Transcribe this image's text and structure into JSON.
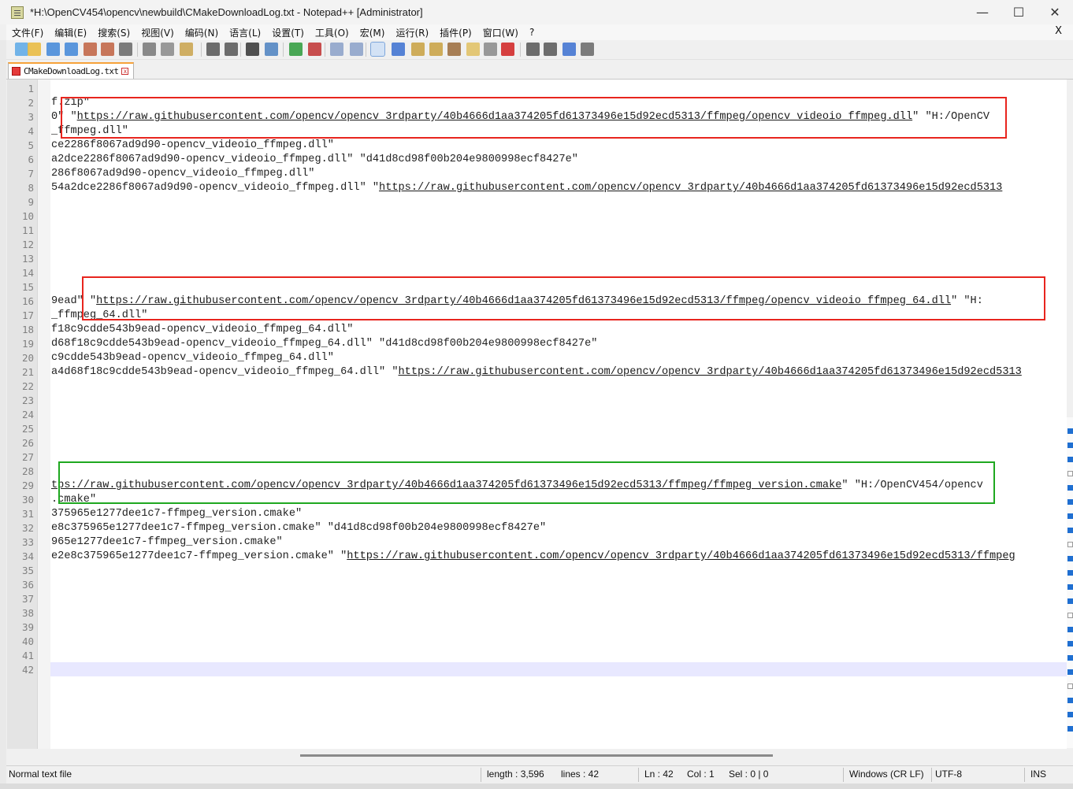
{
  "window": {
    "title": "*H:\\OpenCV454\\opencv\\newbuild\\CMakeDownloadLog.txt - Notepad++ [Administrator]",
    "controls": {
      "minimize": "—",
      "maximize": "☐",
      "close": "✕"
    }
  },
  "menu": {
    "items": [
      "文件(F)",
      "编辑(E)",
      "搜索(S)",
      "视图(V)",
      "编码(N)",
      "语言(L)",
      "设置(T)",
      "工具(O)",
      "宏(M)",
      "运行(R)",
      "插件(P)",
      "窗口(W)",
      "?"
    ],
    "close_label": "X"
  },
  "tab": {
    "label": "CMakeDownloadLog.txt",
    "close": "x"
  },
  "line_numbers": [
    "1",
    "2",
    "3",
    "4",
    "5",
    "6",
    "7",
    "8",
    "9",
    "10",
    "11",
    "12",
    "13",
    "14",
    "15",
    "16",
    "17",
    "18",
    "19",
    "20",
    "21",
    "22",
    "23",
    "24",
    "25",
    "26",
    "27",
    "28",
    "29",
    "30",
    "31",
    "32",
    "33",
    "34",
    "35",
    "36",
    "37",
    "38",
    "39",
    "40",
    "41",
    "42"
  ],
  "lines": [
    {
      "pre": "",
      "url": "",
      "post": ""
    },
    {
      "pre": "f.zip\"",
      "url": "",
      "post": ""
    },
    {
      "pre": "0\" \"",
      "url": "https://raw.githubusercontent.com/opencv/opencv_3rdparty/40b4666d1aa374205fd61373496e15d92ecd5313/ffmpeg/opencv_videoio_ffmpeg.dll",
      "post": "\" \"H:/OpenCV"
    },
    {
      "pre": "_ffmpeg.dll\"",
      "url": "",
      "post": ""
    },
    {
      "pre": "ce2286f8067ad9d90-opencv_videoio_ffmpeg.dll\"",
      "url": "",
      "post": ""
    },
    {
      "pre": "a2dce2286f8067ad9d90-opencv_videoio_ffmpeg.dll\" \"d41d8cd98f00b204e9800998ecf8427e\"",
      "url": "",
      "post": ""
    },
    {
      "pre": "286f8067ad9d90-opencv_videoio_ffmpeg.dll\"",
      "url": "",
      "post": ""
    },
    {
      "pre": "54a2dce2286f8067ad9d90-opencv_videoio_ffmpeg.dll\" \"",
      "url": "https://raw.githubusercontent.com/opencv/opencv_3rdparty/40b4666d1aa374205fd61373496e15d92ecd5313",
      "post": ""
    },
    {
      "pre": "",
      "url": "",
      "post": ""
    },
    {
      "pre": "",
      "url": "",
      "post": ""
    },
    {
      "pre": "",
      "url": "",
      "post": ""
    },
    {
      "pre": "",
      "url": "",
      "post": ""
    },
    {
      "pre": "",
      "url": "",
      "post": ""
    },
    {
      "pre": "",
      "url": "",
      "post": ""
    },
    {
      "pre": "",
      "url": "",
      "post": ""
    },
    {
      "pre": "9ead\" \"",
      "url": "https://raw.githubusercontent.com/opencv/opencv_3rdparty/40b4666d1aa374205fd61373496e15d92ecd5313/ffmpeg/opencv_videoio_ffmpeg_64.dll",
      "post": "\" \"H:"
    },
    {
      "pre": "_ffmpeg_64.dll\"",
      "url": "",
      "post": ""
    },
    {
      "pre": "f18c9cdde543b9ead-opencv_videoio_ffmpeg_64.dll\"",
      "url": "",
      "post": ""
    },
    {
      "pre": "d68f18c9cdde543b9ead-opencv_videoio_ffmpeg_64.dll\" \"d41d8cd98f00b204e9800998ecf8427e\"",
      "url": "",
      "post": ""
    },
    {
      "pre": "c9cdde543b9ead-opencv_videoio_ffmpeg_64.dll\"",
      "url": "",
      "post": ""
    },
    {
      "pre": "a4d68f18c9cdde543b9ead-opencv_videoio_ffmpeg_64.dll\" \"",
      "url": "https://raw.githubusercontent.com/opencv/opencv_3rdparty/40b4666d1aa374205fd61373496e15d92ecd5313",
      "post": ""
    },
    {
      "pre": "",
      "url": "",
      "post": ""
    },
    {
      "pre": "",
      "url": "",
      "post": ""
    },
    {
      "pre": "",
      "url": "",
      "post": ""
    },
    {
      "pre": "",
      "url": "",
      "post": ""
    },
    {
      "pre": "",
      "url": "",
      "post": ""
    },
    {
      "pre": "",
      "url": "",
      "post": ""
    },
    {
      "pre": "",
      "url": "",
      "post": ""
    },
    {
      "pre": "",
      "url": "tps://raw.githubusercontent.com/opencv/opencv_3rdparty/40b4666d1aa374205fd61373496e15d92ecd5313/ffmpeg/ffmpeg_version.cmake",
      "post": "\" \"H:/OpenCV454/opencv"
    },
    {
      "pre": ".cmake\"",
      "url": "",
      "post": ""
    },
    {
      "pre": "375965e1277dee1c7-ffmpeg_version.cmake\"",
      "url": "",
      "post": ""
    },
    {
      "pre": "e8c375965e1277dee1c7-ffmpeg_version.cmake\" \"d41d8cd98f00b204e9800998ecf8427e\"",
      "url": "",
      "post": ""
    },
    {
      "pre": "965e1277dee1c7-ffmpeg_version.cmake\"",
      "url": "",
      "post": ""
    },
    {
      "pre": "e2e8c375965e1277dee1c7-ffmpeg_version.cmake\" \"",
      "url": "https://raw.githubusercontent.com/opencv/opencv_3rdparty/40b4666d1aa374205fd61373496e15d92ecd5313/ffmpeg",
      "post": ""
    },
    {
      "pre": "",
      "url": "",
      "post": ""
    },
    {
      "pre": "",
      "url": "",
      "post": ""
    },
    {
      "pre": "",
      "url": "",
      "post": ""
    },
    {
      "pre": "",
      "url": "",
      "post": ""
    },
    {
      "pre": "",
      "url": "",
      "post": ""
    },
    {
      "pre": "",
      "url": "",
      "post": ""
    },
    {
      "pre": "",
      "url": "",
      "post": ""
    },
    {
      "pre": "",
      "url": "",
      "post": ""
    }
  ],
  "status": {
    "file_type": "Normal text file",
    "length": "length : 3,596",
    "lines": "lines : 42",
    "ln": "Ln : 42",
    "col": "Col : 1",
    "sel": "Sel : 0 | 0",
    "eol": "Windows (CR LF)",
    "encoding": "UTF-8",
    "mode": "INS"
  },
  "annotations": {
    "red_color": "#e8251e",
    "green_color": "#1fa820"
  },
  "toolbar_icons": [
    "new-file-icon",
    "open-file-icon",
    "save-icon",
    "save-all-icon",
    "close-icon",
    "close-all-icon",
    "print-icon",
    "cut-icon",
    "copy-icon",
    "paste-icon",
    "undo-icon",
    "redo-icon",
    "find-icon",
    "replace-icon",
    "zoom-in-icon",
    "zoom-out-icon",
    "sync-vertical-icon",
    "sync-horizontal-icon",
    "word-wrap-icon",
    "show-all-chars-icon",
    "indent-guide-icon",
    "doc-map-icon",
    "function-list-icon",
    "folder-workspace-icon",
    "monitoring-icon",
    "record-macro-icon",
    "stop-record-icon",
    "play-macro-icon",
    "run-macro-multiple-icon",
    "save-macro-icon"
  ]
}
